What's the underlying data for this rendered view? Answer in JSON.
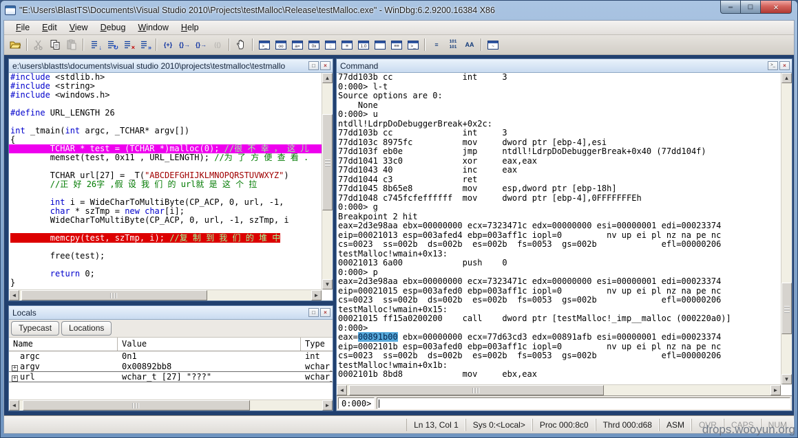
{
  "window": {
    "title": "\"E:\\Users\\BlastTS\\Documents\\Visual Studio 2010\\Projects\\testMalloc\\Release\\testMalloc.exe\" - WinDbg:6.2.9200.16384 X86",
    "controls": {
      "minimize": "–",
      "maximize": "□",
      "close": "×"
    }
  },
  "menu": {
    "items": [
      {
        "label": "File",
        "u": 0
      },
      {
        "label": "Edit",
        "u": 0
      },
      {
        "label": "View",
        "u": 0
      },
      {
        "label": "Debug",
        "u": 0
      },
      {
        "label": "Window",
        "u": 0
      },
      {
        "label": "Help",
        "u": 0
      }
    ]
  },
  "toolbar": {
    "items": [
      {
        "name": "open-source-file-button",
        "svg": "i-folder"
      },
      {
        "sep": true
      },
      {
        "name": "cut-button",
        "svg": "i-cut",
        "disabled": true
      },
      {
        "name": "copy-button",
        "svg": "i-copy"
      },
      {
        "name": "paste-button",
        "svg": "i-paste",
        "disabled": true
      },
      {
        "sep": true
      },
      {
        "name": "go-button",
        "svg": "i-list",
        "ov": "↓",
        "ovc": "blue"
      },
      {
        "name": "restart-button",
        "svg": "i-list",
        "ov": "↻",
        "ovc": "blue"
      },
      {
        "name": "stop-debugging-button",
        "svg": "i-list",
        "ov": "×",
        "ovc": "red"
      },
      {
        "name": "detach-button",
        "svg": "i-list",
        "ov": "»",
        "ovc": "blue"
      },
      {
        "sep": true
      },
      {
        "name": "breakpoint-insert-button",
        "text": "{+}",
        "tc": "blue"
      },
      {
        "name": "breakpoint-step-over-button",
        "text": "{}→",
        "tc": "blue"
      },
      {
        "name": "breakpoint-step-out-button",
        "text": "{}→",
        "tc": "blue"
      },
      {
        "name": "breakpoint-disabled-button",
        "text": "({)",
        "tc": "gray",
        "disabled": true
      },
      {
        "sep": true
      },
      {
        "name": "break-button",
        "svg": "i-hand"
      },
      {
        "sep": true
      },
      {
        "name": "command-window-button",
        "win": ">_"
      },
      {
        "name": "watch-window-button",
        "win": "oo"
      },
      {
        "name": "locals-window-button",
        "win": "a="
      },
      {
        "name": "registers-window-button",
        "win": "0x"
      },
      {
        "name": "memory-window-button",
        "win": "::"
      },
      {
        "name": "callstack-window-button",
        "win": "≡"
      },
      {
        "name": "scratchpad-window-button",
        "win": "1.0"
      },
      {
        "name": "blank-window-button",
        "win": ""
      },
      {
        "name": "disassembly-window-button",
        "win": "≡≡"
      },
      {
        "name": "command-window-2-button",
        "win": ">_"
      },
      {
        "sep": true
      },
      {
        "name": "source-mode-button",
        "text": "≡",
        "tc": "navy"
      },
      {
        "name": "memory-101-button",
        "text": "101\n101",
        "tc": "navy",
        "small": true
      },
      {
        "name": "font-button",
        "text": "AA",
        "tc": "navy"
      },
      {
        "sep": true
      },
      {
        "name": "options-button",
        "win": "~"
      }
    ]
  },
  "source_pane": {
    "path_title": "e:\\users\\blastts\\documents\\visual studio 2010\\projects\\testmalloc\\testmallo",
    "float_button": "□",
    "close_button": "×",
    "lines": [
      {
        "seg": [
          [
            "kw",
            "#include"
          ],
          [
            "pl",
            " <stdlib.h>"
          ]
        ]
      },
      {
        "seg": [
          [
            "kw",
            "#include"
          ],
          [
            "pl",
            " <string>"
          ]
        ]
      },
      {
        "seg": [
          [
            "kw",
            "#include"
          ],
          [
            "pl",
            " <windows.h>"
          ]
        ]
      },
      {
        "seg": []
      },
      {
        "seg": [
          [
            "kw",
            "#define"
          ],
          [
            "pl",
            " URL_LENGTH 26"
          ]
        ]
      },
      {
        "seg": []
      },
      {
        "seg": [
          [
            "kw",
            "int"
          ],
          [
            "pl",
            " _tmain("
          ],
          [
            "kw",
            "int"
          ],
          [
            "pl",
            " argc, _TCHAR* argv[])"
          ]
        ]
      },
      {
        "seg": [
          [
            "pl",
            "{"
          ]
        ]
      },
      {
        "hl": "magenta",
        "seg": [
          [
            "wh",
            "        TCHAR * test = (TCHAR *)malloc(0); "
          ],
          [
            "cmh",
            "//很 不 幸 ， 这 儿"
          ]
        ]
      },
      {
        "seg": [
          [
            "pl",
            "        memset(test, 0x11 , URL_LENGTH); "
          ],
          [
            "cm",
            "//为 了 方 便 查 看 ."
          ]
        ]
      },
      {
        "seg": []
      },
      {
        "seg": [
          [
            "pl",
            "        TCHAR url[27] = _T("
          ],
          [
            "str",
            "\"ABCDEFGHIJKLMNOPQRSTUVWXYZ\""
          ],
          [
            "pl",
            ")"
          ]
        ]
      },
      {
        "seg": [
          [
            "cm",
            "        //正 好 26字 ,假 设 我 们 的 url就 是 这 个 拉"
          ]
        ]
      },
      {
        "seg": []
      },
      {
        "seg": [
          [
            "pl",
            "        "
          ],
          [
            "kw",
            "int"
          ],
          [
            "pl",
            " i = WideCharToMultiByte(CP_ACP, 0, url, -1,"
          ]
        ]
      },
      {
        "seg": [
          [
            "pl",
            "        "
          ],
          [
            "kw",
            "char"
          ],
          [
            "pl",
            " * szTmp = "
          ],
          [
            "kw",
            "new"
          ],
          [
            "pl",
            " "
          ],
          [
            "kw",
            "char"
          ],
          [
            "pl",
            "[i];"
          ]
        ]
      },
      {
        "seg": [
          [
            "pl",
            "        WideCharToMultiByte(CP_ACP, 0, url, -1, szTmp, i"
          ]
        ]
      },
      {
        "seg": []
      },
      {
        "hl": "red",
        "seg": [
          [
            "wh",
            "        memcpy(test, szTmp, i); "
          ],
          [
            "cmh",
            "//复 制 到 我 们 的 堆 中"
          ]
        ]
      },
      {
        "seg": []
      },
      {
        "seg": [
          [
            "pl",
            "        free(test);"
          ]
        ]
      },
      {
        "seg": []
      },
      {
        "seg": [
          [
            "pl",
            "        "
          ],
          [
            "kw",
            "return"
          ],
          [
            "pl",
            " 0;"
          ]
        ]
      },
      {
        "seg": [
          [
            "pl",
            "}"
          ]
        ]
      }
    ]
  },
  "locals_pane": {
    "title": "Locals",
    "dock_button": "□",
    "close_button": "×",
    "tabs": [
      "Typecast",
      "Locations"
    ],
    "columns": [
      "Name",
      "Value",
      "Type"
    ],
    "rows": [
      {
        "exp": "",
        "name": "argc",
        "value": "0n1",
        "type": "int",
        "line": false
      },
      {
        "exp": "+",
        "name": "argv",
        "value": "0x00892bb8",
        "type": "wchar_t",
        "line": true
      },
      {
        "exp": "+",
        "name": "url",
        "value": "wchar_t [27] \"???\"",
        "type": "wchar_t",
        "line": true
      }
    ]
  },
  "command_pane": {
    "title": "Command",
    "cmd_button": ">_",
    "close_button": "×",
    "prompt": "0:000>",
    "lines": [
      {
        "seg": [
          [
            "pl",
            "77dd103b cc              int     3"
          ]
        ]
      },
      {
        "seg": [
          [
            "pl",
            "0:000> l-t"
          ]
        ]
      },
      {
        "seg": [
          [
            "pl",
            "Source options are 0:"
          ]
        ]
      },
      {
        "seg": [
          [
            "pl",
            "    None"
          ]
        ]
      },
      {
        "seg": [
          [
            "pl",
            "0:000> u"
          ]
        ]
      },
      {
        "seg": [
          [
            "pl",
            "ntdll!LdrpDoDebuggerBreak+0x2c:"
          ]
        ]
      },
      {
        "seg": [
          [
            "pl",
            "77dd103b cc              int     3"
          ]
        ]
      },
      {
        "seg": [
          [
            "pl",
            "77dd103c 8975fc          mov     dword ptr [ebp-4],esi"
          ]
        ]
      },
      {
        "seg": [
          [
            "pl",
            "77dd103f eb0e            jmp     ntdll!LdrpDoDebuggerBreak+0x40 (77dd104f)"
          ]
        ]
      },
      {
        "seg": [
          [
            "pl",
            "77dd1041 33c0            xor     eax,eax"
          ]
        ]
      },
      {
        "seg": [
          [
            "pl",
            "77dd1043 40              inc     eax"
          ]
        ]
      },
      {
        "seg": [
          [
            "pl",
            "77dd1044 c3              ret"
          ]
        ]
      },
      {
        "seg": [
          [
            "pl",
            "77dd1045 8b65e8          mov     esp,dword ptr [ebp-18h]"
          ]
        ]
      },
      {
        "seg": [
          [
            "pl",
            "77dd1048 c745fcfeffffff  mov     dword ptr [ebp-4],0FFFFFFFEh"
          ]
        ]
      },
      {
        "seg": [
          [
            "pl",
            "0:000> g"
          ]
        ]
      },
      {
        "seg": [
          [
            "pl",
            "Breakpoint 2 hit"
          ]
        ]
      },
      {
        "seg": [
          [
            "pl",
            "eax=2d3e98aa ebx=00000000 ecx=7323471c edx=00000000 esi=00000001 edi=00023374"
          ]
        ]
      },
      {
        "seg": [
          [
            "pl",
            "eip=00021013 esp=003afed4 ebp=003aff1c iopl=0         nv up ei pl nz na pe nc"
          ]
        ]
      },
      {
        "seg": [
          [
            "pl",
            "cs=0023  ss=002b  ds=002b  es=002b  fs=0053  gs=002b             efl=00000206"
          ]
        ]
      },
      {
        "seg": [
          [
            "pl",
            "testMalloc!wmain+0x13:"
          ]
        ]
      },
      {
        "seg": [
          [
            "pl",
            "00021013 6a00            push    0"
          ]
        ]
      },
      {
        "seg": [
          [
            "pl",
            "0:000> p"
          ]
        ]
      },
      {
        "seg": [
          [
            "pl",
            "eax=2d3e98aa ebx=00000000 ecx=7323471c edx=00000000 esi=00000001 edi=00023374"
          ]
        ]
      },
      {
        "seg": [
          [
            "pl",
            "eip=00021015 esp=003afed0 ebp=003aff1c iopl=0         nv up ei pl nz na pe nc"
          ]
        ]
      },
      {
        "seg": [
          [
            "pl",
            "cs=0023  ss=002b  ds=002b  es=002b  fs=0053  gs=002b             efl=00000206"
          ]
        ]
      },
      {
        "seg": [
          [
            "pl",
            "testMalloc!wmain+0x15:"
          ]
        ]
      },
      {
        "seg": [
          [
            "pl",
            "00021015 ff15a0200200    call    dword ptr [testMalloc!_imp__malloc (000220a0)]"
          ]
        ]
      },
      {
        "seg": [
          [
            "pl",
            "0:000>"
          ]
        ]
      },
      {
        "seg": [
          [
            "pl",
            "eax="
          ],
          [
            "sel",
            "00891b00"
          ],
          [
            "pl",
            " ebx=00000000 ecx=77d63cd3 edx=00891afb esi=00000001 edi=00023374"
          ]
        ]
      },
      {
        "seg": [
          [
            "pl",
            "eip=0002101b esp=003afed0 ebp=003aff1c iopl=0         nv up ei pl nz na pe nc"
          ]
        ]
      },
      {
        "seg": [
          [
            "pl",
            "cs=0023  ss=002b  ds=002b  es=002b  fs=0053  gs=002b             efl=00000206"
          ]
        ]
      },
      {
        "seg": [
          [
            "pl",
            "testMalloc!wmain+0x1b:"
          ]
        ]
      },
      {
        "seg": [
          [
            "pl",
            "0002101b 8bd8            mov     ebx,eax"
          ]
        ]
      }
    ]
  },
  "status_bar": {
    "segments": [
      {
        "t": "Ln 13, Col 1",
        "dim": false
      },
      {
        "t": "Sys 0:<Local>",
        "dim": false
      },
      {
        "t": "Proc 000:8c0",
        "dim": false
      },
      {
        "t": "Thrd 000:d68",
        "dim": false
      },
      {
        "t": "ASM",
        "dim": false
      },
      {
        "t": "OVR",
        "dim": true
      },
      {
        "t": "CAPS",
        "dim": true
      },
      {
        "t": "NUM",
        "dim": true
      }
    ]
  },
  "watermark": "drops.wooyun.org",
  "colors": {
    "titlebar": "#8fb0d6",
    "mdi_background": "#21406f",
    "current_line_highlight": "#ee00ee",
    "breakpoint_highlight": "#dc0000",
    "selection": "#57aadc",
    "keyword": "#0000cc",
    "comment": "#007a00",
    "string": "#a00000"
  }
}
